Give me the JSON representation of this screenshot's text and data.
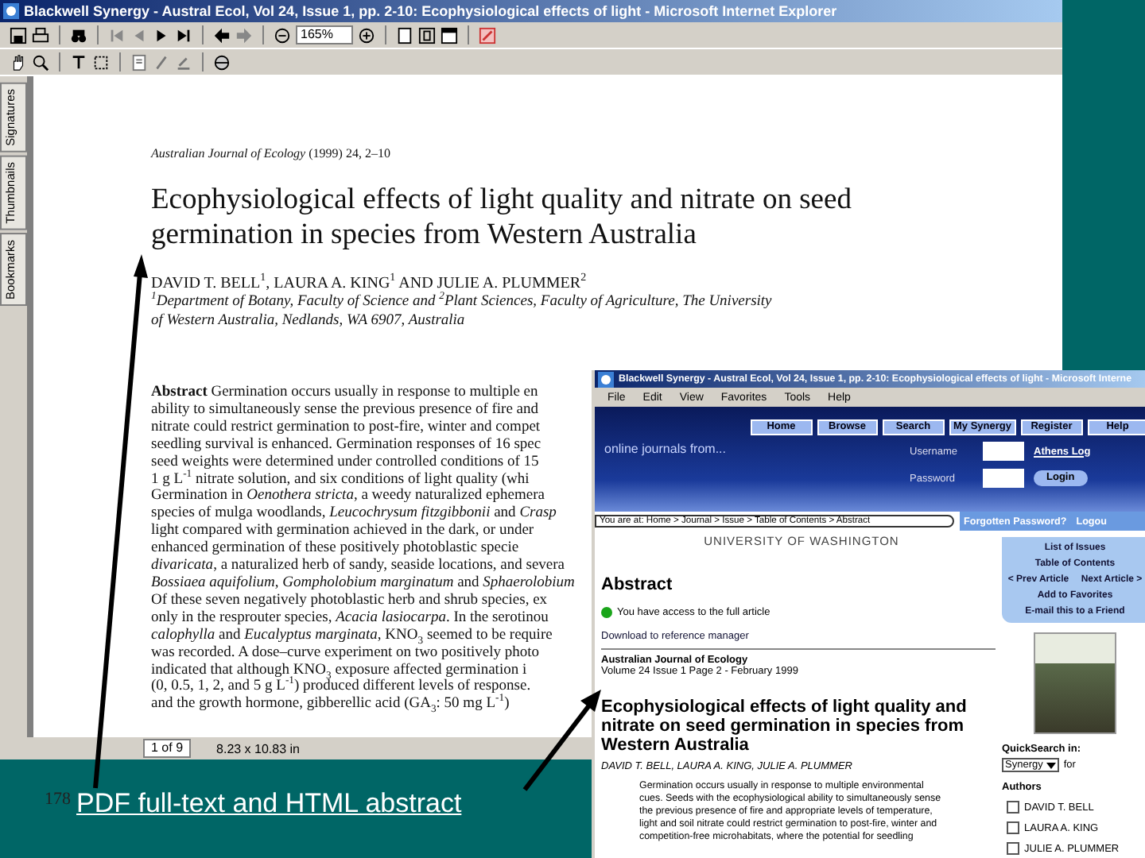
{
  "pdf_window": {
    "title": "Blackwell Synergy - Austral Ecol, Vol 24, Issue 1, pp. 2-10: Ecophysiological effects of light - Microsoft Internet Explorer",
    "zoom": "165%",
    "side_tabs": [
      "Bookmarks",
      "Thumbnails",
      "Signatures"
    ],
    "page": {
      "citation": "*Australian Journal of Ecology* (1999) 24, 2–10",
      "title": "Ecophysiological effects of light quality and nitrate on seed germination in species from Western Australia",
      "authors": "DAVID T. BELL$^{1}$, LAURA A. KING$^{1}$ AND JULIE A. PLUMMER$^{2}$",
      "affiliation_lines": [
        "$^{1}$Department of Botany, Faculty of Science and $^{2}$Plant Sciences, Faculty of Agriculture, The University",
        "of Western Australia, Nedlands, WA 6907, Australia"
      ],
      "abstract_lines": [
        "**Abstract**   Germination occurs usually in response to multiple en",
        "ability to simultaneously sense the previous presence of fire and",
        "nitrate could restrict germination to post-fire, winter and compet",
        "seedling survival is enhanced. Germination responses of 16 spec",
        "seed weights were determined under controlled conditions of 15",
        "1 g L$^{-1}$ nitrate solution, and six conditions of light quality (whi",
        "Germination in *Oenothera stricta*, a weedy naturalized ephemera",
        "species of mulga woodlands, *Leucochrysum fitzgibbonii* and *Crasp*",
        "light compared with germination achieved in the dark, or under",
        "enhanced germination of these positively photoblastic specie",
        "*divaricata*, a naturalized herb of sandy, seaside locations, and severa",
        "*Bossiaea aquifolium*, *Gompholobium marginatum* and *Sphaerolobium*",
        "Of these seven negatively photoblastic herb and shrub species, ex",
        "only in the resprouter species, *Acacia lasiocarpa*. In the serotinou",
        "*calophylla* and *Eucalyptus marginata*, KNO$_{3}$ seemed to be require",
        "was recorded. A dose–curve experiment on two positively photo",
        "indicated that although KNO$_{3}$ exposure affected germination i",
        "(0, 0.5, 1, 2, and 5 g L$^{-1}$) produced different levels of response.",
        "and the growth hormone, gibberellic acid (GA$_{3}$: 50 mg L$^{-1}$)"
      ]
    },
    "status": {
      "page": "1 of 9",
      "size": "8.23 x 10.83 in"
    }
  },
  "browser_window": {
    "title": "Blackwell Synergy - Austral Ecol, Vol 24, Issue 1, pp. 2-10: Ecophysiological effects of light - Microsoft Interne",
    "menu": [
      "File",
      "Edit",
      "View",
      "Favorites",
      "Tools",
      "Help"
    ],
    "tagline": "online journals from...",
    "nav_buttons": [
      "Home",
      "Browse",
      "Search",
      "My Synergy",
      "Register",
      "Help"
    ],
    "username_label": "Username",
    "password_label": "Password",
    "athens": "Athens Log",
    "login": "Login",
    "forgotten": "Forgotten Password?",
    "logout": "Logou",
    "breadcrumb": "You are at: Home > Journal > Issue > Table of Contents > Abstract",
    "institution": "UNIVERSITY OF WASHINGTON",
    "heading": "Abstract",
    "access": "You have access to the full article",
    "download": "Download to reference manager",
    "journal": "Australian Journal of Ecology",
    "issue": "Volume 24 Issue 1 Page 2 - February 1999",
    "article_title": "Ecophysiological effects of light quality and nitrate on seed germination in species from Western Australia",
    "authors": "DAVID T. BELL, LAURA A. KING, JULIE A. PLUMMER",
    "abstract_lines": [
      "Germination occurs usually in response to multiple environmental",
      "cues. Seeds with the ecophysiological ability to simultaneously sense",
      "the previous presence of fire and appropriate levels of temperature,",
      "light and soil nitrate could restrict germination to post-fire, winter and",
      "competition-free microhabitats, where the potential for seedling"
    ],
    "sidebar_rows": [
      [
        "List of Issues"
      ],
      [
        "Table of Contents"
      ],
      [
        "< Prev Article",
        "Next Article >"
      ],
      [
        "Add to Favorites"
      ],
      [
        "E-mail this to a Friend"
      ]
    ],
    "quicksearch_label": "QuickSearch in:",
    "quicksearch_select": "Synergy",
    "quicksearch_for": "for",
    "authors_heading": "Authors",
    "author_checks": [
      {
        "name": "DAVID T. BELL",
        "checked": false
      },
      {
        "name": "LAURA A. KING",
        "checked": false
      },
      {
        "name": "JULIE A. PLUMMER",
        "checked": false
      }
    ]
  },
  "slide_number": "178",
  "caption": "PDF full-text and HTML abstract"
}
